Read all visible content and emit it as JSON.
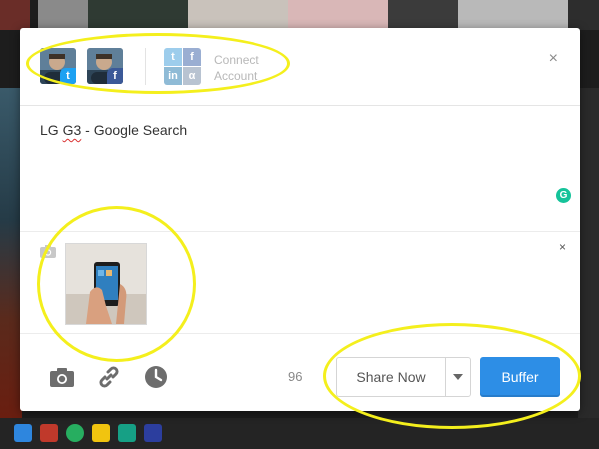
{
  "modal": {
    "profiles": [
      {
        "network": "twitter",
        "icon": "twitter-icon",
        "glyph": "t"
      },
      {
        "network": "facebook",
        "icon": "facebook-icon",
        "glyph": "f"
      }
    ],
    "connect": {
      "label_line1": "Connect",
      "label_line2": "Account",
      "tiles": [
        {
          "glyph": "t",
          "color": "#9dcdec"
        },
        {
          "glyph": "f",
          "color": "#9aaed2"
        },
        {
          "glyph": "in",
          "color": "#8fbbd6"
        },
        {
          "glyph": "α",
          "color": "#b8c3d1"
        }
      ]
    },
    "close_glyph": "×",
    "composer": {
      "text_prefix": "LG ",
      "text_misspelled": "G3",
      "text_suffix": " - Google Search",
      "grammarly_glyph": "G"
    },
    "media": {
      "remove_glyph": "×"
    },
    "footer": {
      "char_count": "96",
      "share_now_label": "Share Now",
      "buffer_label": "Buffer"
    }
  },
  "colors": {
    "accent": "#2d8ee6",
    "twitter": "#1da1f2",
    "facebook": "#3b5998",
    "highlight": "#f4ef1d"
  }
}
